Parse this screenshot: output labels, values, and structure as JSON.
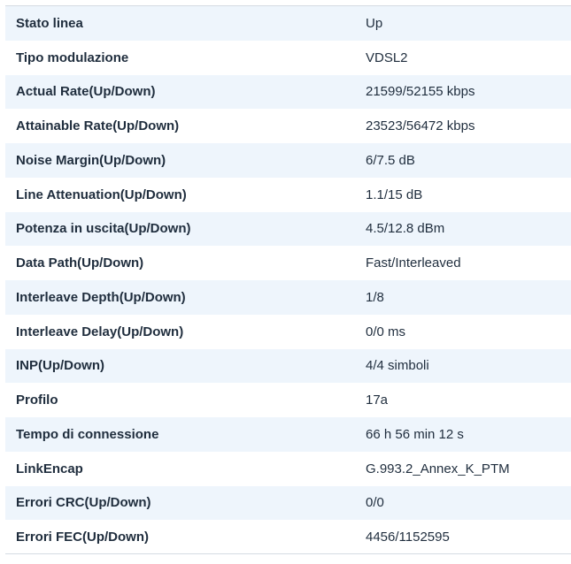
{
  "rows": [
    {
      "label": "Stato linea",
      "value": "Up"
    },
    {
      "label": "Tipo modulazione",
      "value": "VDSL2"
    },
    {
      "label": "Actual Rate(Up/Down)",
      "value": "21599/52155 kbps"
    },
    {
      "label": "Attainable Rate(Up/Down)",
      "value": "23523/56472 kbps"
    },
    {
      "label": "Noise Margin(Up/Down)",
      "value": "6/7.5 dB"
    },
    {
      "label": "Line Attenuation(Up/Down)",
      "value": "1.1/15 dB"
    },
    {
      "label": "Potenza in uscita(Up/Down)",
      "value": "4.5/12.8 dBm"
    },
    {
      "label": "Data Path(Up/Down)",
      "value": "Fast/Interleaved"
    },
    {
      "label": "Interleave Depth(Up/Down)",
      "value": "1/8"
    },
    {
      "label": "Interleave Delay(Up/Down)",
      "value": "0/0 ms"
    },
    {
      "label": "INP(Up/Down)",
      "value": "4/4 simboli"
    },
    {
      "label": "Profilo",
      "value": "17a"
    },
    {
      "label": "Tempo di connessione",
      "value": "66 h 56 min 12 s"
    },
    {
      "label": "LinkEncap",
      "value": "G.993.2_Annex_K_PTM"
    },
    {
      "label": "Errori CRC(Up/Down)",
      "value": "0/0"
    },
    {
      "label": "Errori FEC(Up/Down)",
      "value": "4456/1152595"
    }
  ]
}
